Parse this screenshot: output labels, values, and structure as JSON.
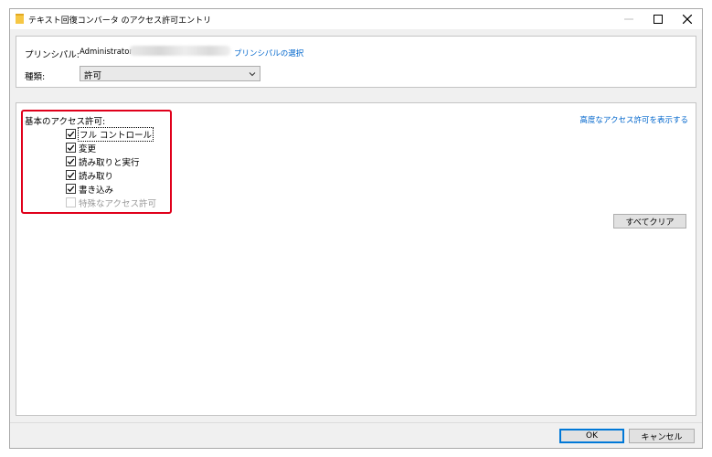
{
  "window": {
    "title": "テキスト回復コンバータ のアクセス許可エントリ",
    "icon": "folder-icon",
    "controls": {
      "minimize": "—",
      "maximize": "☐",
      "close": "✕"
    }
  },
  "principal": {
    "label": "プリンシパル:",
    "value": "Administrator",
    "select_link": "プリンシパルの選択"
  },
  "type": {
    "label": "種類:",
    "selected": "許可"
  },
  "basic_permissions": {
    "heading": "基本のアクセス許可:",
    "items": [
      {
        "label": "フル コントロール",
        "checked": true,
        "enabled": true
      },
      {
        "label": "変更",
        "checked": true,
        "enabled": true
      },
      {
        "label": "読み取りと実行",
        "checked": true,
        "enabled": true
      },
      {
        "label": "読み取り",
        "checked": true,
        "enabled": true
      },
      {
        "label": "書き込み",
        "checked": true,
        "enabled": true
      },
      {
        "label": "特殊なアクセス許可",
        "checked": false,
        "enabled": false
      }
    ]
  },
  "advanced_link": "高度なアクセス許可を表示する",
  "clear_all_label": "すべてクリア",
  "footer": {
    "ok_label": "OK",
    "cancel_label": "キャンセル"
  },
  "colors": {
    "link": "#0066cc",
    "highlight": "#e0001b",
    "accent": "#0078d7"
  }
}
